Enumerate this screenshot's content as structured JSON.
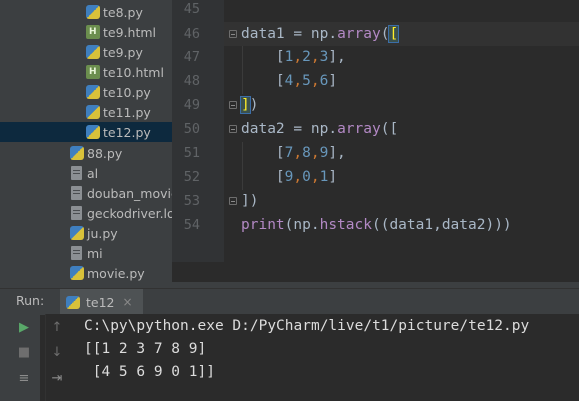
{
  "project_tree": {
    "items": [
      {
        "label": "te8.py",
        "type": "py"
      },
      {
        "label": "te9.html",
        "type": "html"
      },
      {
        "label": "te9.py",
        "type": "py"
      },
      {
        "label": "te10.html",
        "type": "html"
      },
      {
        "label": "te10.py",
        "type": "py"
      },
      {
        "label": "te11.py",
        "type": "py"
      },
      {
        "label": "te12.py",
        "type": "py",
        "selected": true
      },
      {
        "label": "88.py",
        "type": "py"
      },
      {
        "label": "al",
        "type": "file"
      },
      {
        "label": "douban_movie",
        "type": "file"
      },
      {
        "label": "geckodriver.log",
        "type": "file"
      },
      {
        "label": "ju.py",
        "type": "py"
      },
      {
        "label": "mi",
        "type": "file"
      },
      {
        "label": "movie.py",
        "type": "py"
      }
    ]
  },
  "editor": {
    "line_numbers": [
      "45",
      "46",
      "47",
      "48",
      "49",
      "50",
      "51",
      "52",
      "53",
      "54"
    ],
    "lines": {
      "l46": {
        "var": "data1",
        "eq": " = ",
        "mod": "np",
        "dot": ".",
        "fn": "array",
        "open": "(",
        "br": "["
      },
      "l47": {
        "text1": "[",
        "a": "1",
        "c1": ",",
        "b": "2",
        "c2": ",",
        "c": "3",
        "text2": "],"
      },
      "l48": {
        "text1": "[",
        "a": "4",
        "c1": ",",
        "b": "5",
        "c2": ",",
        "c": "6",
        "text2": "]"
      },
      "l49": {
        "br": "]",
        "close": ")"
      },
      "l50": {
        "var": "data2",
        "eq": " = ",
        "mod": "np",
        "dot": ".",
        "fn": "array",
        "open": "(["
      },
      "l51": {
        "text1": "[",
        "a": "7",
        "c1": ",",
        "b": "8",
        "c2": ",",
        "c": "9",
        "text2": "],"
      },
      "l52": {
        "text1": "[",
        "a": "9",
        "c1": ",",
        "b": "0",
        "c2": ",",
        "c": "1",
        "text2": "]"
      },
      "l53": {
        "text": "])"
      },
      "l54": {
        "fn": "print",
        "open": "(",
        "mod": "np",
        "dot": ".",
        "fn2": "hstack",
        "args": "((data1,data2)))"
      }
    }
  },
  "run_panel": {
    "label": "Run:",
    "tab": "te12",
    "close": "×",
    "output": [
      "C:\\py\\python.exe D:/PyCharm/live/t1/picture/te12.py",
      "[[1 2 3 7 8 9]",
      " [4 5 6 9 0 1]]"
    ]
  },
  "colors": {
    "accent_selection": "#0d293e",
    "run_green": "#59a869"
  }
}
